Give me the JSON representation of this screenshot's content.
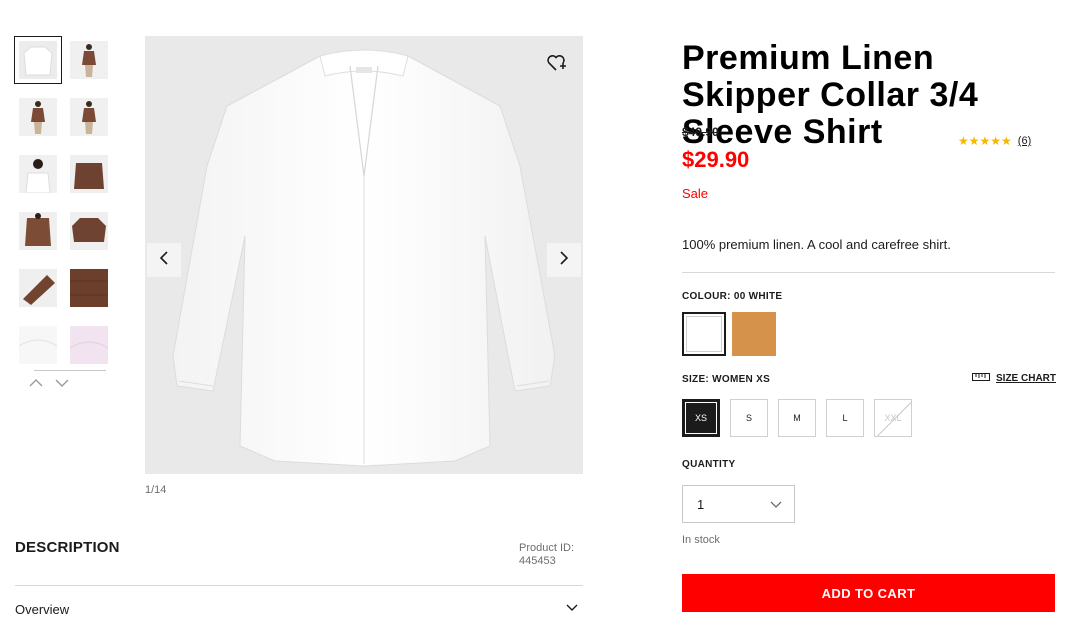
{
  "gallery": {
    "counter": "1/14",
    "thumbnails": [
      {
        "kind": "white-shirt-flat"
      },
      {
        "kind": "brown-model-full"
      },
      {
        "kind": "brown-model-full"
      },
      {
        "kind": "brown-model-full"
      },
      {
        "kind": "white-model-half"
      },
      {
        "kind": "brown-detail"
      },
      {
        "kind": "brown-model-half"
      },
      {
        "kind": "brown-shirt-flat"
      },
      {
        "kind": "brown-sleeve-detail"
      },
      {
        "kind": "brown-fabric-detail"
      },
      {
        "kind": "white-fabric-detail"
      },
      {
        "kind": "pink-fabric-detail"
      }
    ],
    "icons": {
      "prev": "chevron-left-icon",
      "next": "chevron-right-icon",
      "favorite": "heart-plus-icon",
      "up": "chevron-up-icon",
      "down": "chevron-down-icon"
    }
  },
  "description": {
    "heading": "DESCRIPTION",
    "product_id_label": "Product ID:",
    "product_id": "445453",
    "overview_label": "Overview"
  },
  "product": {
    "title": "Premium Linen Skipper Collar 3/4 Sleeve Shirt",
    "old_price": "$49.90",
    "price": "$29.90",
    "sale_label": "Sale",
    "rating_stars": "★★★★★",
    "rating_value": 5,
    "rating_count": "(6)",
    "blurb": "100% premium linen. A cool and carefree shirt."
  },
  "colour": {
    "label": "COLOUR: 00 WHITE",
    "options": [
      {
        "name": "00 WHITE",
        "hex": "#ffffff",
        "selected": true
      },
      {
        "name": "brown",
        "hex": "#d4924a",
        "selected": false
      }
    ]
  },
  "size": {
    "label": "SIZE: WOMEN XS",
    "chart_label": "SIZE CHART",
    "options": [
      {
        "label": "XS",
        "state": "selected"
      },
      {
        "label": "S",
        "state": "available"
      },
      {
        "label": "M",
        "state": "available"
      },
      {
        "label": "L",
        "state": "available"
      },
      {
        "label": "XXL",
        "state": "unavailable"
      }
    ]
  },
  "quantity": {
    "label": "QUANTITY",
    "value": "1",
    "stock": "In stock"
  },
  "cart": {
    "button_label": "ADD TO CART"
  },
  "colors": {
    "accent": "#ff0000",
    "rating": "#f5b500",
    "text": "#1b1b1b"
  }
}
